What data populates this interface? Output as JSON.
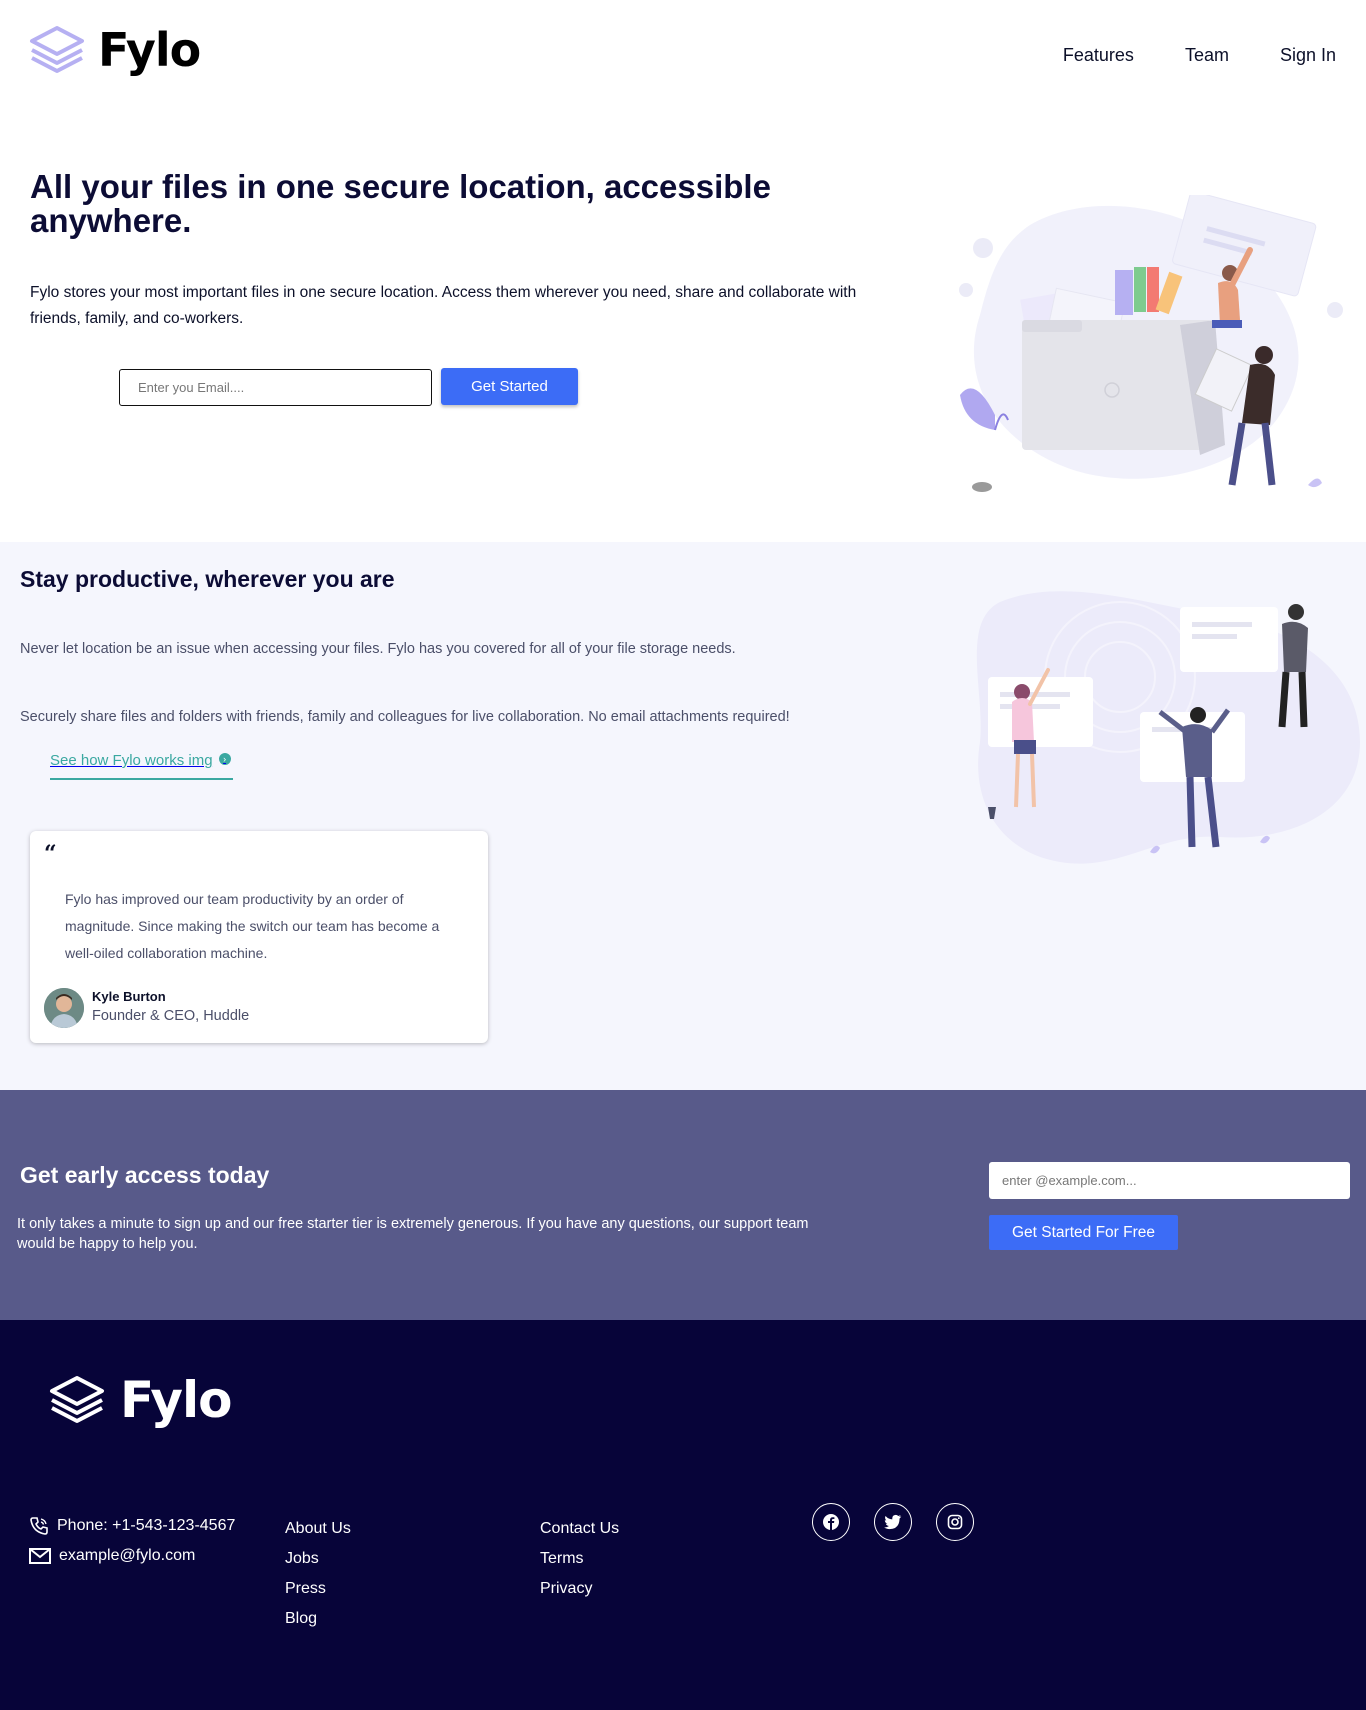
{
  "header": {
    "brand": "Fylo",
    "nav": {
      "features": "Features",
      "team": "Team",
      "sign_in": "Sign In"
    }
  },
  "hero": {
    "title": "All your files in one secure location, accessible anywhere.",
    "description": "Fylo stores your most important files in one secure location. Access them wherever you need, share and collaborate with friends, family, and co-workers.",
    "email_placeholder": "Enter you Email....",
    "cta_label": "Get Started"
  },
  "productive": {
    "title": "Stay productive, wherever you are",
    "paragraph1": "Never let location be an issue when accessing your files. Fylo has you covered for all of your file storage needs.",
    "paragraph2": "Securely share files and folders with friends, family and colleagues for live collaboration. No email attachments required!",
    "link_label": "See how Fylo works img",
    "testimonial": {
      "quote_mark": "“",
      "text": "Fylo has improved our team productivity by an order of magnitude. Since making the switch our team has become a well-oiled collaboration machine.",
      "name": "Kyle Burton",
      "role": "Founder & CEO, Huddle"
    }
  },
  "early_access": {
    "title": "Get early access today",
    "description": "It only takes a minute to sign up and our free starter tier is extremely generous. If you have any questions, our support team would be happy to help you.",
    "email_placeholder": "enter @example.com...",
    "cta_label": "Get Started For Free"
  },
  "footer": {
    "brand": "Fylo",
    "phone": "Phone: +1-543-123-4567",
    "email": "example@fylo.com",
    "col1": [
      "About Us",
      "Jobs",
      "Press",
      "Blog"
    ],
    "col2": [
      "Contact Us",
      "Terms",
      "Privacy"
    ],
    "social": [
      "facebook-icon",
      "twitter-icon",
      "instagram-icon"
    ]
  },
  "colors": {
    "accent_blue": "#3c6cf6",
    "teal_link": "#3aa8a1",
    "early_bg": "#585a8a",
    "footer_bg": "#070439",
    "section_bg": "#f5f6fd"
  }
}
